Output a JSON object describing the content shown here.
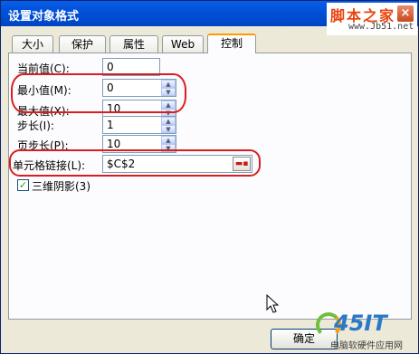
{
  "window": {
    "title": "设置对象格式",
    "close_glyph": "×"
  },
  "watermark_top": {
    "main": "脚本之家",
    "url": "www.Jb51.net"
  },
  "tabs": [
    {
      "label": "大小",
      "active": false
    },
    {
      "label": "保护",
      "active": false
    },
    {
      "label": "属性",
      "active": false
    },
    {
      "label": "Web",
      "active": false
    },
    {
      "label": "控制",
      "active": true
    }
  ],
  "control": {
    "current_value": {
      "label": "当前值(C):",
      "value": "0"
    },
    "min_value": {
      "label": "最小值(M):",
      "value": "0"
    },
    "max_value": {
      "label": "最大值(X):",
      "value": "10"
    },
    "step": {
      "label": "步长(I):",
      "value": "1"
    },
    "page_step": {
      "label": "页步长(P):",
      "value": "10"
    },
    "cell_link": {
      "label": "单元格链接(L):",
      "value": "$C$2"
    },
    "shading_3d": {
      "label": "三维阴影(3)",
      "checked": true
    }
  },
  "buttons": {
    "ok": "确定"
  },
  "watermark_bottom": {
    "logo": "45IT",
    "sub": "电脑软硬件应用网"
  },
  "colors": {
    "titlebar": "#0054e3",
    "highlight": "#d81e1e",
    "tab_active": "#ff9c00"
  }
}
